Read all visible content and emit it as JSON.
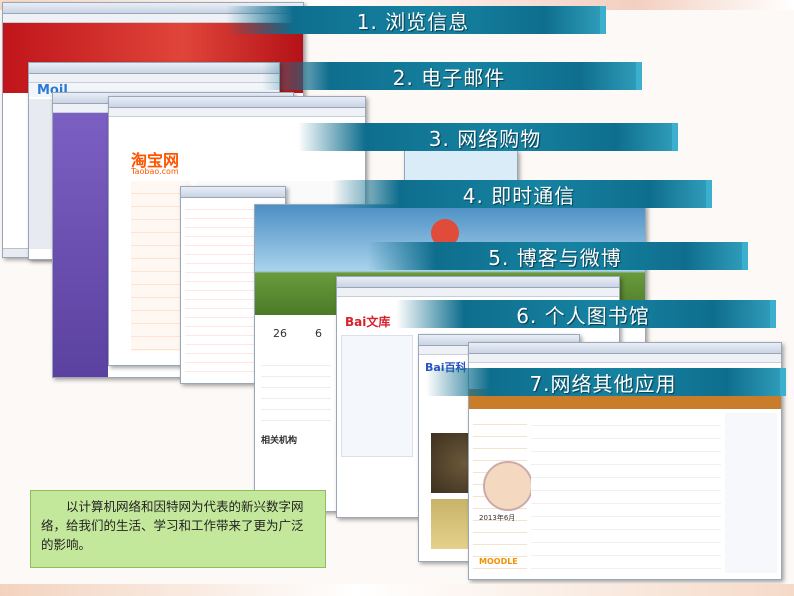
{
  "banners": [
    "1. 浏览信息",
    "2. 电子邮件",
    "3. 网络购物",
    "4. 即时通信",
    "5. 博客与微博",
    "6. 个人图书馆",
    "7.网络其他应用"
  ],
  "note_text": "以计算机网络和因特网为代表的新兴数字网络，给我们的生活、学习和工作带来了更为广泛的影响。",
  "shots": {
    "mail_logo": "Moil",
    "taobao_logo": "淘宝网",
    "taobao_sub": "Taobao.com",
    "wenku_logo": "Bai文库",
    "baike_logo": "Bai百科",
    "blog_stat1": "26",
    "blog_stat2": "6",
    "friend_title": "相关机构",
    "moodle": "MOODLE",
    "calendar_month": "2013年6月"
  },
  "colors": {
    "banner": "#1683a2",
    "note_bg": "#c4e89b",
    "mail_purple": "#6a4fb0",
    "taobao_orange": "#ff5500",
    "baidu_red": "#d8212e",
    "baidu_blue": "#2a54c4"
  }
}
